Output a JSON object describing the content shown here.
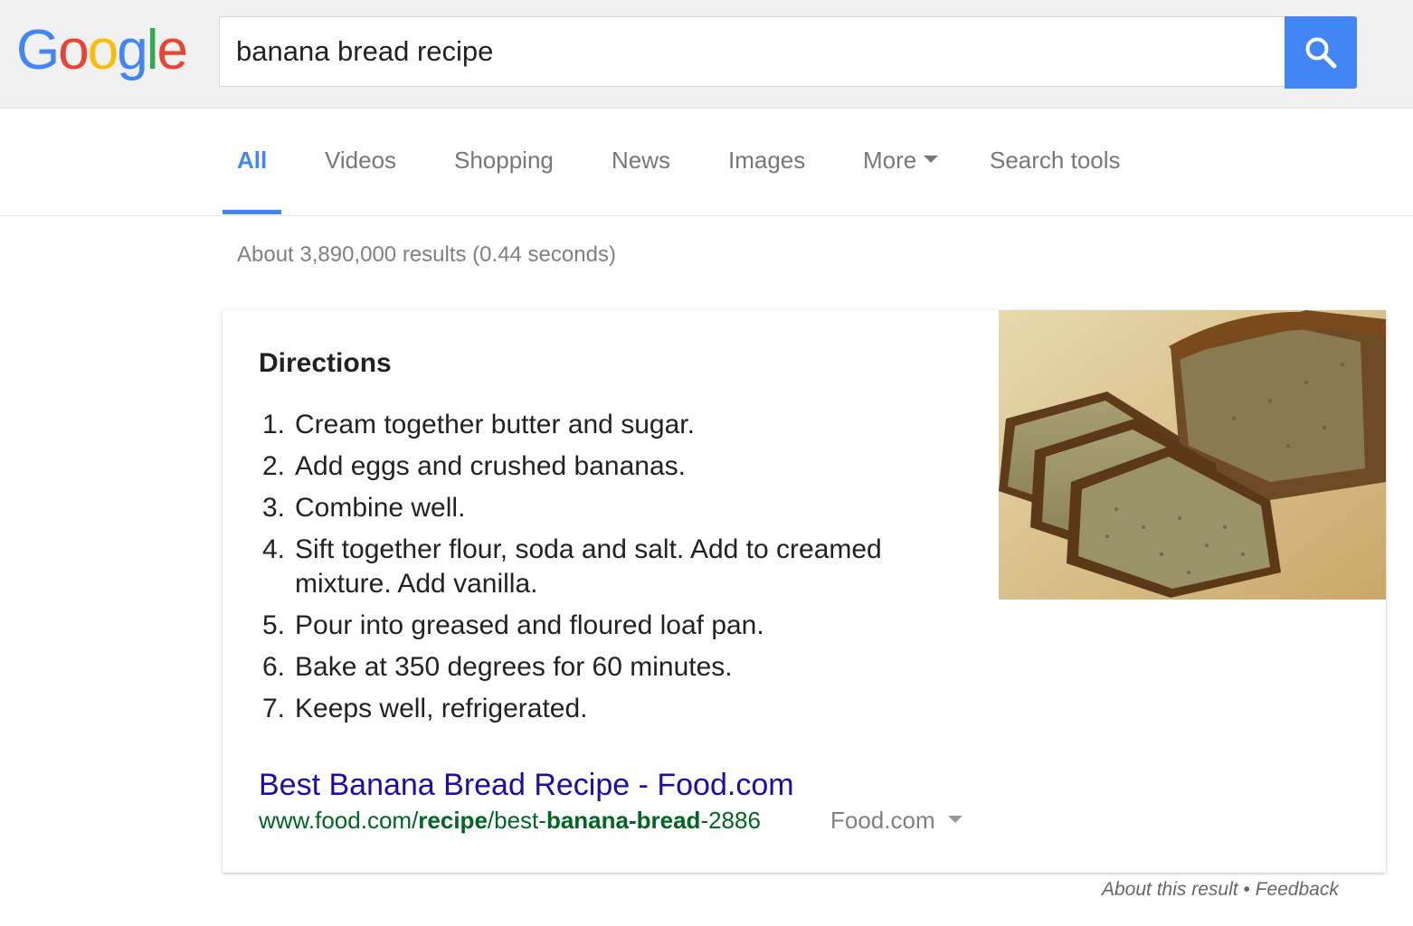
{
  "logo": {
    "letters": [
      {
        "char": "G",
        "color": "#4285f4"
      },
      {
        "char": "o",
        "color": "#ea4335"
      },
      {
        "char": "o",
        "color": "#fbbc05"
      },
      {
        "char": "g",
        "color": "#4285f4"
      },
      {
        "char": "l",
        "color": "#34a853"
      },
      {
        "char": "e",
        "color": "#ea4335"
      }
    ]
  },
  "search": {
    "query": "banana bread recipe",
    "button_icon": "search-icon",
    "button_color": "#4285f4"
  },
  "tabs": [
    {
      "label": "All",
      "active": true
    },
    {
      "label": "Videos"
    },
    {
      "label": "Shopping"
    },
    {
      "label": "News"
    },
    {
      "label": "Images"
    },
    {
      "label": "More",
      "icon": "caret-down-icon"
    },
    {
      "label": "Search tools"
    }
  ],
  "result_stats": "About 3,890,000 results (0.44 seconds)",
  "featured_snippet": {
    "title": "Directions",
    "steps": [
      {
        "num": "1.",
        "text": "Cream together butter and sugar."
      },
      {
        "num": "2.",
        "text": "Add eggs and crushed bananas."
      },
      {
        "num": "3.",
        "text": "Combine well."
      },
      {
        "num": "4.",
        "text": "Sift together flour, soda and salt. Add to creamed mixture. Add vanilla."
      },
      {
        "num": "5.",
        "text": "Pour into greased and floured loaf pan."
      },
      {
        "num": "6.",
        "text": "Bake at 350 degrees for 60 minutes."
      },
      {
        "num": "7.",
        "text": "Keeps well, refrigerated."
      }
    ],
    "link_title": "Best Banana Bread Recipe - Food.com",
    "url_parts": {
      "prefix": "www.food.com/",
      "bold1": "recipe",
      "mid": "/best-",
      "bold2": "banana-bread",
      "suffix": "-2886"
    },
    "source": "Food.com",
    "image": "banana-bread-photo"
  },
  "footer": {
    "about": "About this result",
    "separator": " • ",
    "feedback": "Feedback"
  }
}
